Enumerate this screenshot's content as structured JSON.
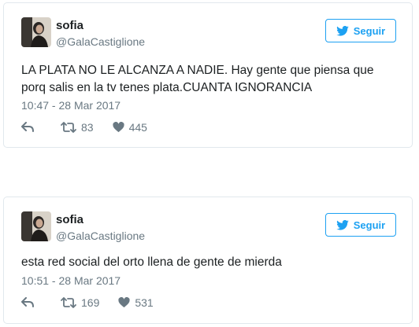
{
  "tweets": [
    {
      "name": "sofia",
      "handle": "@GalaCastiglione",
      "follow_label": "Seguir",
      "text": "LA PLATA NO LE ALCANZA A NADIE. Hay gente que piensa que porq salis en la tv tenes plata.CUANTA IGNORANCIA",
      "timestamp": "10:47 - 28 Mar 2017",
      "retweets": "83",
      "likes": "445"
    },
    {
      "name": "sofia",
      "handle": "@GalaCastiglione",
      "follow_label": "Seguir",
      "text": "esta red social del orto llena de gente de mierda",
      "timestamp": "10:51 - 28 Mar 2017",
      "retweets": "169",
      "likes": "531"
    }
  ],
  "colors": {
    "accent": "#1da1f2",
    "text": "#1c2022",
    "muted": "#697882",
    "border": "#e1e8ed"
  },
  "icons": {
    "follow": "twitter-bird-icon",
    "reply": "reply-icon",
    "retweet": "retweet-icon",
    "like": "heart-icon"
  }
}
